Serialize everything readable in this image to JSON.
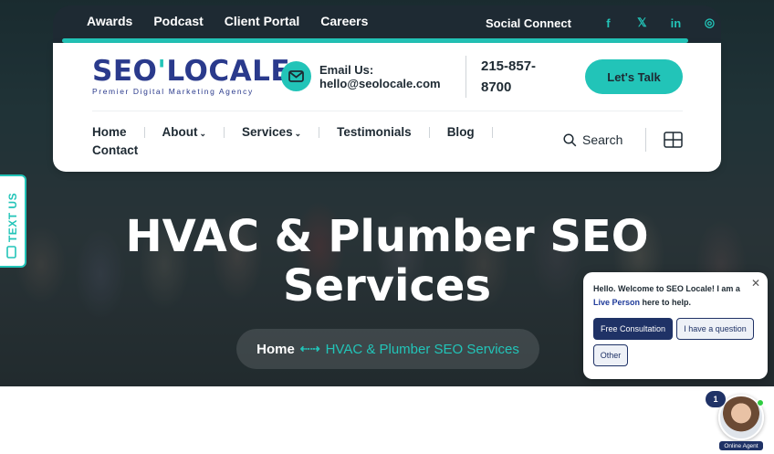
{
  "topbar": {
    "links": [
      "Awards",
      "Podcast",
      "Client Portal",
      "Careers"
    ],
    "social_label": "Social Connect",
    "social_icons": [
      {
        "name": "facebook-icon",
        "glyph": "f"
      },
      {
        "name": "x-icon",
        "glyph": "𝕏"
      },
      {
        "name": "linkedin-icon",
        "glyph": "in"
      },
      {
        "name": "instagram-icon",
        "glyph": "◎"
      }
    ]
  },
  "header": {
    "logo_main_a": "SEO",
    "logo_main_b": "'",
    "logo_main_c": "LOCALE",
    "logo_tagline": "Premier Digital Marketing Agency",
    "email_label": "Email Us:",
    "email_value": "hello@seolocale.com",
    "phone": "215-857-8700",
    "cta": "Let's Talk"
  },
  "nav": {
    "items": [
      {
        "label": "Home",
        "dropdown": false
      },
      {
        "label": "About",
        "dropdown": true
      },
      {
        "label": "Services",
        "dropdown": true
      },
      {
        "label": "Testimonials",
        "dropdown": false
      },
      {
        "label": "Blog",
        "dropdown": false
      }
    ],
    "second_row": "Contact",
    "search_label": "Search"
  },
  "hero": {
    "title_line1": "HVAC & Plumber SEO",
    "title_line2": "Services",
    "breadcrumb_home": "Home",
    "breadcrumb_sep": "⇠⇢",
    "breadcrumb_current": "HVAC & Plumber SEO Services"
  },
  "text_us": "TEXT US",
  "chat": {
    "message_a": "Hello. Welcome to SEO Locale! I am a",
    "message_link": "Live Person",
    "message_b": "here to help.",
    "options": [
      "Free Consultation",
      "I have a question",
      "Other"
    ],
    "badge": "1",
    "agent_label": "Online Agent"
  },
  "colors": {
    "accent": "#22c4b8",
    "brand": "#2a3a8c",
    "dark": "#1e2a33"
  }
}
